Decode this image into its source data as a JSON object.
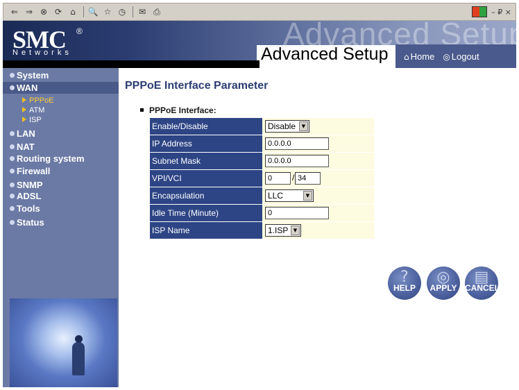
{
  "browser": {
    "nav_icons": [
      "back-icon",
      "forward-icon",
      "stop-icon",
      "refresh-icon",
      "home-icon",
      "search-icon",
      "favorites-icon",
      "history-icon",
      "mail-icon",
      "print-icon"
    ],
    "window_controls": "– ₽ ×"
  },
  "header": {
    "logo": "SMC",
    "logo_mark": "®",
    "logo_sub": "Networks",
    "ghost_title": "Advanced Setup",
    "page_title": "Advanced Setup",
    "home_label": "Home",
    "logout_label": "Logout"
  },
  "sidebar": {
    "items": [
      {
        "label": "System"
      },
      {
        "label": "WAN"
      },
      {
        "label": "LAN"
      },
      {
        "label": "NAT"
      },
      {
        "label": "Routing system"
      },
      {
        "label": "Firewall"
      },
      {
        "label": "SNMP"
      },
      {
        "label": "ADSL"
      },
      {
        "label": "Tools"
      },
      {
        "label": "Status"
      }
    ],
    "wan_sub": [
      {
        "label": "PPPoE"
      },
      {
        "label": "ATM"
      },
      {
        "label": "ISP"
      }
    ]
  },
  "main": {
    "title": "PPPoE Interface Parameter",
    "section_label": "PPPoE Interface:",
    "fields": {
      "enable_label": "Enable/Disable",
      "enable_value": "Disable",
      "ip_label": "IP Address",
      "ip_value": "0.0.0.0",
      "subnet_label": "Subnet Mask",
      "subnet_value": "0.0.0.0",
      "vpivci_label": "VPI/VCI",
      "vpi_value": "0",
      "vci_value": "34",
      "vpivci_sep": "/",
      "encap_label": "Encapsulation",
      "encap_value": "LLC",
      "idle_label": "Idle Time (Minute)",
      "idle_value": "0",
      "isp_label": "ISP Name",
      "isp_value": "1.ISP"
    }
  },
  "buttons": {
    "help": "HELP",
    "apply": "APPLY",
    "cancel": "CANCEL"
  },
  "colors": {
    "sidebar_bg": "#6b7aa5",
    "label_bg": "#2d4585",
    "value_bg": "#fdfbe0",
    "title_color": "#2b3d73",
    "sub_selected": "#ffcc33"
  }
}
